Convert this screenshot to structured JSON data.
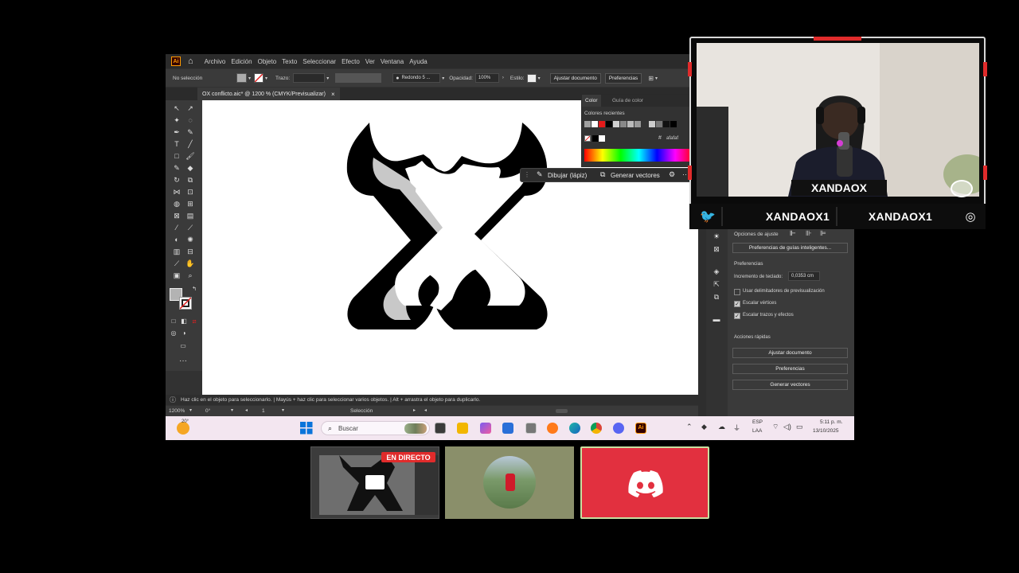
{
  "illustrator": {
    "menu": [
      "Archivo",
      "Edición",
      "Objeto",
      "Texto",
      "Seleccionar",
      "Efecto",
      "Ver",
      "Ventana",
      "Ayuda"
    ],
    "control_bar": {
      "selection": "No selección",
      "stroke_label": "Trazo:",
      "brush": "Redondo 5 ...",
      "opacity_label": "Opacidad:",
      "opacity_value": "100%",
      "style_label": "Estilo:",
      "adjust_doc_button": "Ajustar documento",
      "prefs_button": "Preferencias"
    },
    "doc_tab": "OX conflicto.aic* @ 1200 % (CMYK/Previsualizar)",
    "doc_tab_close": "×",
    "color_panel": {
      "tabs": [
        "Color",
        "Guía de color"
      ],
      "recent_label": "Colores recientes",
      "hex": "afafaf",
      "hex_hash": "#"
    },
    "draw_bar": {
      "draw": "Dibujar (lápiz)",
      "vectorize": "Generar vectores",
      "more": "···"
    },
    "properties": {
      "snap_label": "Opciones de ajuste",
      "smart_guides_button": "Preferencias de guías inteligentes...",
      "prefs_heading": "Preferencias",
      "keyboard_inc_label": "Incremento de teclado:",
      "keyboard_inc_value": "0,0353 cm",
      "check_preview_bounds": "Usar delimitadores de previsualización",
      "check_scale_corners": "Escalar vértices",
      "check_scale_strokes": "Escalar trazos y efectos",
      "quick_actions_heading": "Acciones rápidas",
      "quick_adjust": "Ajustar documento",
      "quick_prefs": "Preferencias",
      "quick_vectorize": "Generar vectores"
    },
    "status_hint": "Haz clic en el objeto para seleccionarlo. | Mayús + haz clic para seleccionar varios objetos. | Alt + arrastra el objeto para duplicarlo.",
    "zoom": "1200%",
    "rotation": "0°",
    "artboard": "1",
    "mode": "Selección"
  },
  "taskbar": {
    "weather": "20°",
    "search_placeholder": "Buscar",
    "lang_top": "ESP",
    "lang_bottom": "LAA",
    "time": "5:11 p. m.",
    "date": "13/10/2025"
  },
  "stream": {
    "webcam_banner": "XANDAOX",
    "twitter_handle": "XANDAOX1",
    "instagram_handle": "XANDAOX1",
    "live_badge": "EN DIRECTO"
  },
  "colors": {
    "live_red": "#e02b2b",
    "discord_tile": "#e2303f",
    "thumb_green": "#8a8f6a",
    "ai_orange": "#ff9a00"
  }
}
